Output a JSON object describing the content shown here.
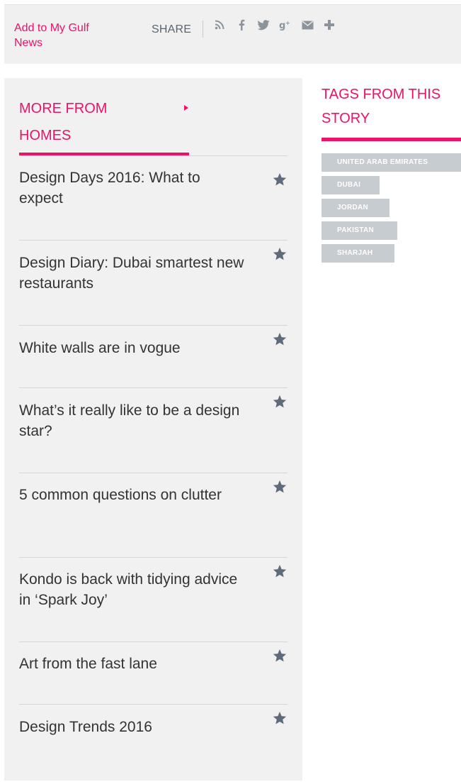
{
  "sharebar": {
    "add_to_my_gulf_news": "Add to My Gulf News",
    "share_label": "SHARE",
    "icons": [
      "rss-icon",
      "facebook-icon",
      "twitter-icon",
      "google-plus-icon",
      "email-icon",
      "more-plus-icon"
    ]
  },
  "more_from": {
    "heading_line1": "MORE FROM",
    "heading_line2": "HOMES",
    "items": [
      {
        "title": "Design Days 2016: What to expect"
      },
      {
        "title": "Design Diary: Dubai smartest new restaurants"
      },
      {
        "title": "White walls are in vogue"
      },
      {
        "title": "What’s it really like to be a design star?"
      },
      {
        "title": "5 common questions on clutter"
      },
      {
        "title": "Kondo is back with tidying advice in ‘Spark Joy’"
      },
      {
        "title": "Art from the fast lane"
      },
      {
        "title": "Design Trends 2016"
      }
    ]
  },
  "tags": {
    "heading_line1": "TAGS FROM THIS",
    "heading_line2": "STORY",
    "items": [
      "UNITED ARAB EMIRATES",
      "DUBAI",
      "JORDAN",
      "PAKISTAN",
      "SHARJAH"
    ]
  },
  "colors": {
    "accent": "#ee1167",
    "panel_bg": "#f1f1f1",
    "tag_bg": "#c7ccd1",
    "star": "#5d6b7a"
  }
}
